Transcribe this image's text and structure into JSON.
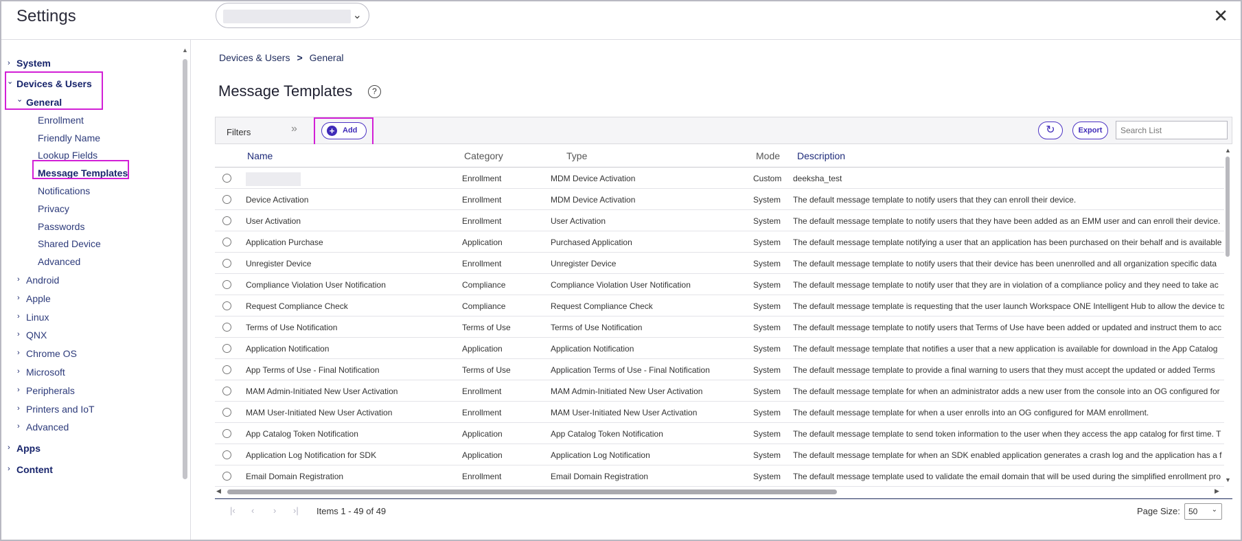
{
  "header": {
    "title": "Settings",
    "org_selector_chevron": "⌄",
    "close_glyph": "✕"
  },
  "sidebar": {
    "items": [
      {
        "label": "System"
      },
      {
        "label": "Devices & Users"
      },
      {
        "label": "General"
      },
      {
        "label": "Enrollment"
      },
      {
        "label": "Friendly Name"
      },
      {
        "label": "Lookup Fields"
      },
      {
        "label": "Message Templates"
      },
      {
        "label": "Notifications"
      },
      {
        "label": "Privacy"
      },
      {
        "label": "Passwords"
      },
      {
        "label": "Shared Device"
      },
      {
        "label": "Advanced"
      },
      {
        "label": "Android"
      },
      {
        "label": "Apple"
      },
      {
        "label": "Linux"
      },
      {
        "label": "QNX"
      },
      {
        "label": "Chrome OS"
      },
      {
        "label": "Microsoft"
      },
      {
        "label": "Peripherals"
      },
      {
        "label": "Printers and IoT"
      },
      {
        "label": "Advanced"
      },
      {
        "label": "Apps"
      },
      {
        "label": "Content"
      }
    ]
  },
  "breadcrumb": {
    "parent": "Devices & Users",
    "separator": ">",
    "current": "General"
  },
  "page": {
    "title": "Message Templates",
    "help_glyph": "?"
  },
  "toolbar": {
    "filters_label": "Filters",
    "expand_glyph": "»",
    "add_label": "Add",
    "add_glyph": "+",
    "refresh_glyph": "↻",
    "export_label": "Export",
    "search_placeholder": "Search List"
  },
  "table": {
    "columns": [
      "Name",
      "Category",
      "Type",
      "Mode",
      "Description"
    ],
    "rows": [
      {
        "name": "",
        "category": "Enrollment",
        "type": "MDM Device Activation",
        "mode": "Custom",
        "description": "deeksha_test"
      },
      {
        "name": "Device Activation",
        "category": "Enrollment",
        "type": "MDM Device Activation",
        "mode": "System",
        "description": "The default message template to notify users that they can enroll their device."
      },
      {
        "name": "User Activation",
        "category": "Enrollment",
        "type": "User Activation",
        "mode": "System",
        "description": "The default message template to notify users that they have been added as an EMM user and can enroll their device."
      },
      {
        "name": "Application Purchase",
        "category": "Application",
        "type": "Purchased Application",
        "mode": "System",
        "description": "The default message template notifying a user that an application has been purchased on their behalf and is available"
      },
      {
        "name": "Unregister Device",
        "category": "Enrollment",
        "type": "Unregister Device",
        "mode": "System",
        "description": "The default message template to notify users that their device has been unenrolled and all organization specific data"
      },
      {
        "name": "Compliance Violation User Notification",
        "category": "Compliance",
        "type": "Compliance Violation User Notification",
        "mode": "System",
        "description": "The default message template to notify user that they are in violation of a compliance policy and they need to take ac"
      },
      {
        "name": "Request Compliance Check",
        "category": "Compliance",
        "type": "Request Compliance Check",
        "mode": "System",
        "description": "The default message template is requesting that the user launch Workspace ONE Intelligent Hub to allow the device to"
      },
      {
        "name": "Terms of Use Notification",
        "category": "Terms of Use",
        "type": "Terms of Use Notification",
        "mode": "System",
        "description": "The default message template to notify users that Terms of Use have been added or updated and instruct them to acc"
      },
      {
        "name": "Application Notification",
        "category": "Application",
        "type": "Application Notification",
        "mode": "System",
        "description": "The default message template that notifies a user that a new application is available for download in the App Catalog"
      },
      {
        "name": "App Terms of Use - Final Notification",
        "category": "Terms of Use",
        "type": "Application Terms of Use - Final Notification",
        "mode": "System",
        "description": "The default message template to provide a final warning to users that they must accept the updated or added Terms"
      },
      {
        "name": "MAM Admin-Initiated New User Activation",
        "category": "Enrollment",
        "type": "MAM Admin-Initiated New User Activation",
        "mode": "System",
        "description": "The default message template for when an administrator adds a new user from the console into an OG configured for"
      },
      {
        "name": "MAM User-Initiated New User Activation",
        "category": "Enrollment",
        "type": "MAM User-Initiated New User Activation",
        "mode": "System",
        "description": "The default message template for when a user enrolls into an OG configured for MAM enrollment."
      },
      {
        "name": "App Catalog Token Notification",
        "category": "Application",
        "type": "App Catalog Token Notification",
        "mode": "System",
        "description": "The default message template to send token information to the user when they access the app catalog for first time. T"
      },
      {
        "name": "Application Log Notification for SDK",
        "category": "Application",
        "type": "Application Log Notification",
        "mode": "System",
        "description": "The default message template for when an SDK enabled application generates a crash log and the application has a f"
      },
      {
        "name": "Email Domain Registration",
        "category": "Enrollment",
        "type": "Email Domain Registration",
        "mode": "System",
        "description": "The default message template used to validate the email domain that will be used during the simplified enrollment pro"
      }
    ]
  },
  "pager": {
    "first_glyph": "|‹",
    "prev_glyph": "‹",
    "next_glyph": "›",
    "last_glyph": "›|",
    "items_text": "Items 1 - 49 of 49",
    "page_size_label": "Page Size:",
    "page_size_value": "50",
    "page_size_chevron": "⌄"
  },
  "colors": {
    "accent": "#3f2bb8",
    "highlight": "#d21ed6",
    "nav_text": "#17246b"
  }
}
